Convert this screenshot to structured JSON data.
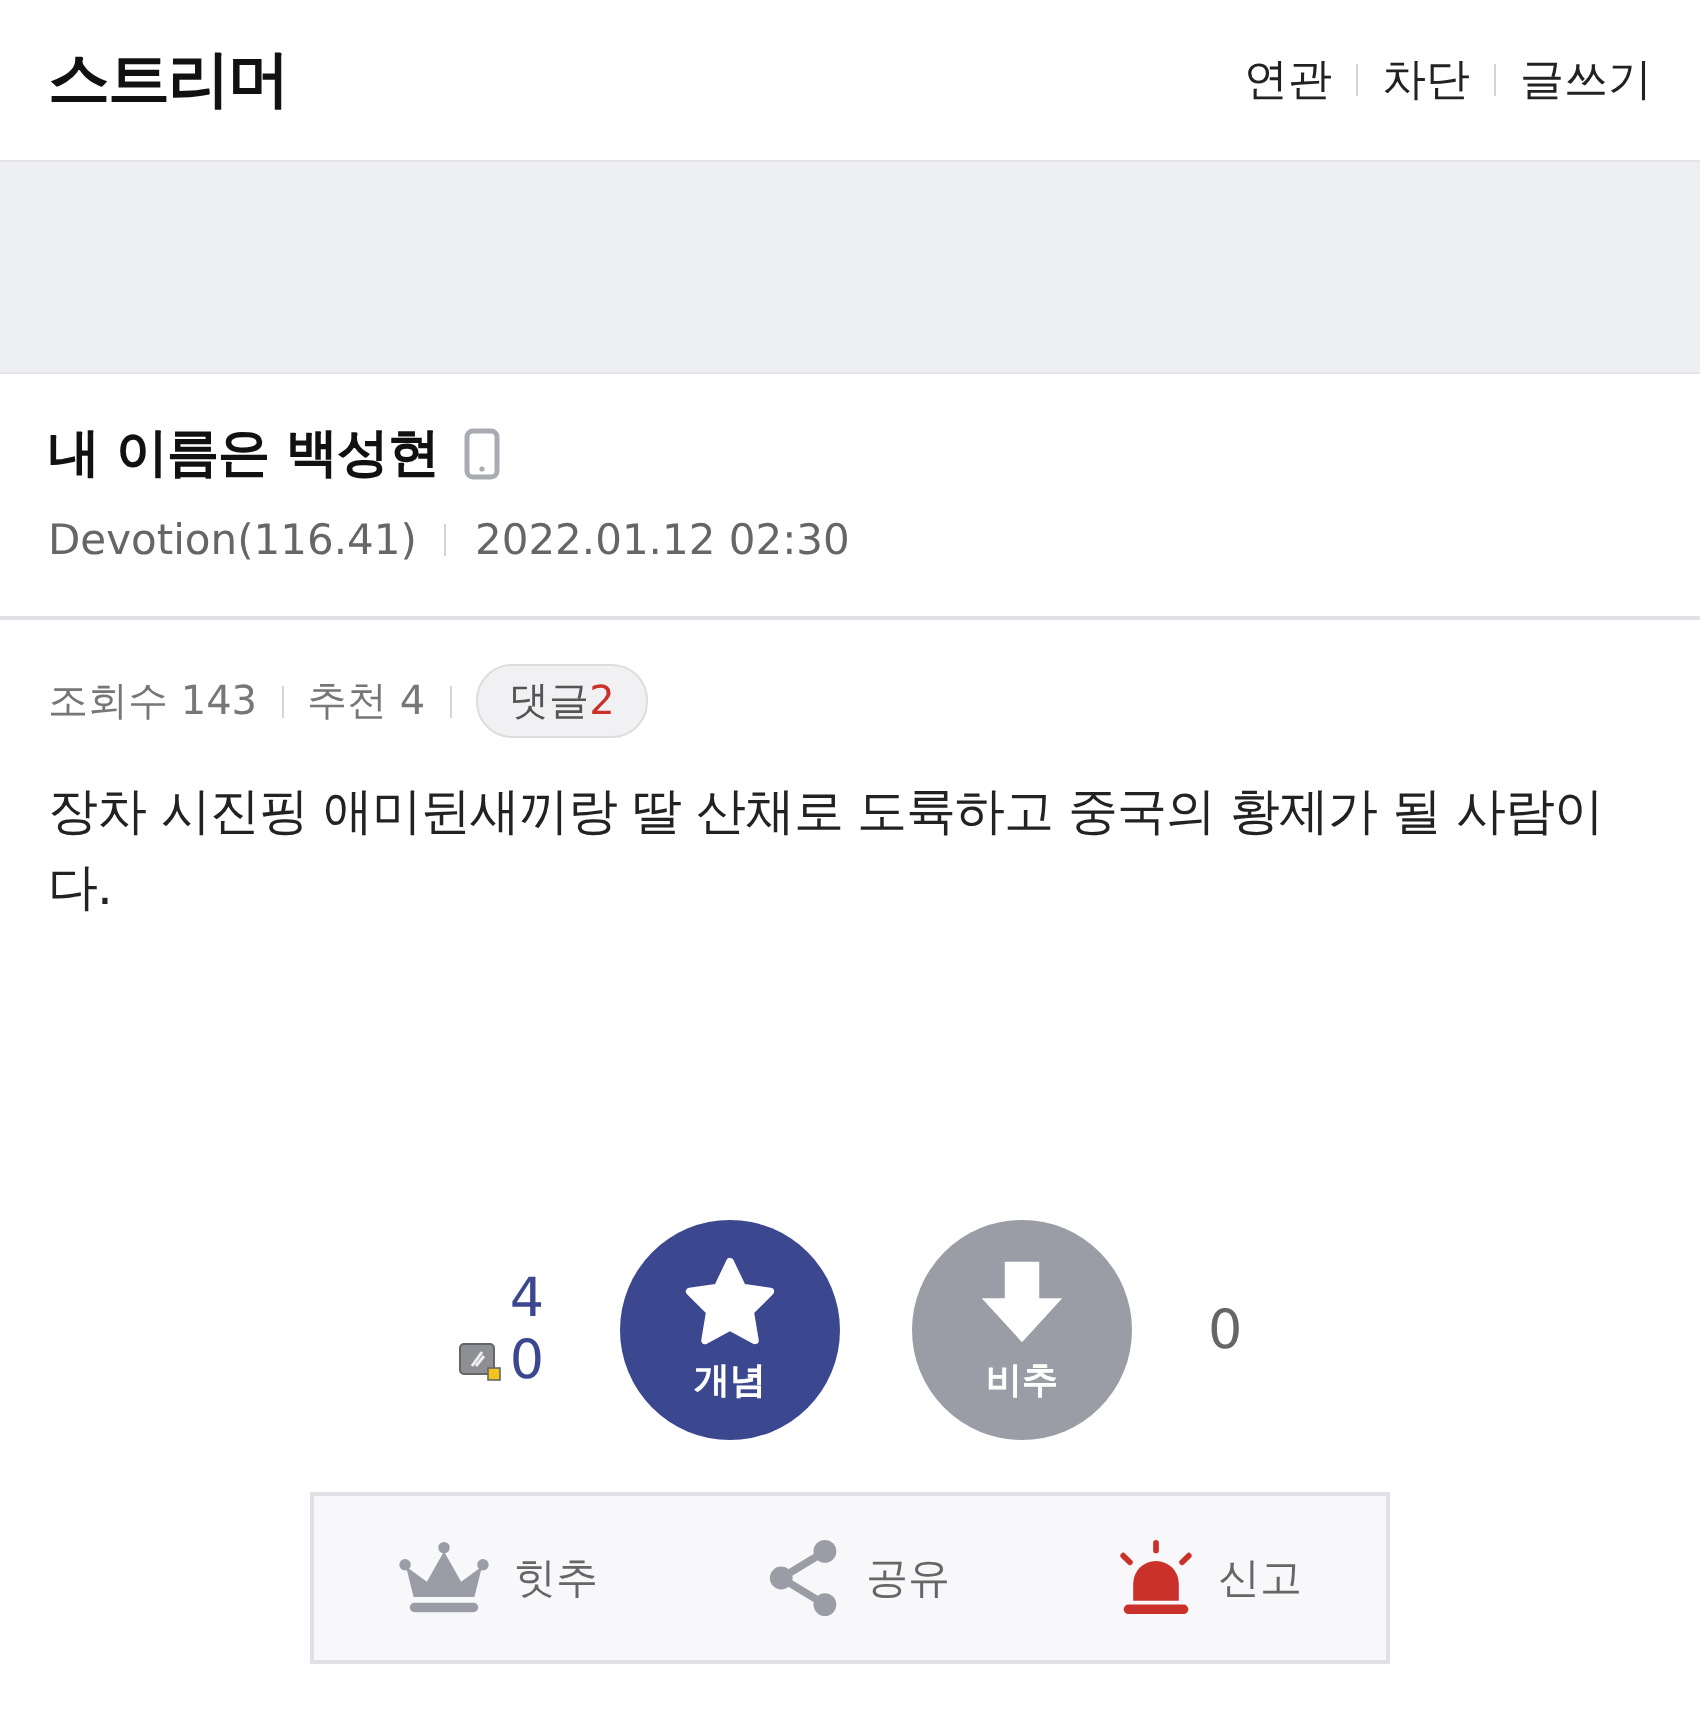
{
  "header": {
    "title": "스트리머",
    "links": [
      "연관",
      "차단",
      "글쓰기"
    ]
  },
  "post": {
    "title": "내 이름은 백성현",
    "author": "Devotion(116.41)",
    "date": "2022.01.12 02:30",
    "views": "조회수 143",
    "recommend": "추천 4",
    "comments_label": "댓글",
    "comments_count": "2",
    "body": "장차 시진핑 애미뒨새끼랑 딸 산채로 도륙하고 중국의 황제가 될 사람이다."
  },
  "votes": {
    "up_count": "4",
    "fixed_count": "0",
    "up_label": "개념",
    "down_label": "비추",
    "down_count": "0"
  },
  "actions": [
    {
      "kind": "crown",
      "label": "힛추"
    },
    {
      "kind": "share",
      "label": "공유"
    },
    {
      "kind": "siren",
      "label": "신고"
    }
  ]
}
